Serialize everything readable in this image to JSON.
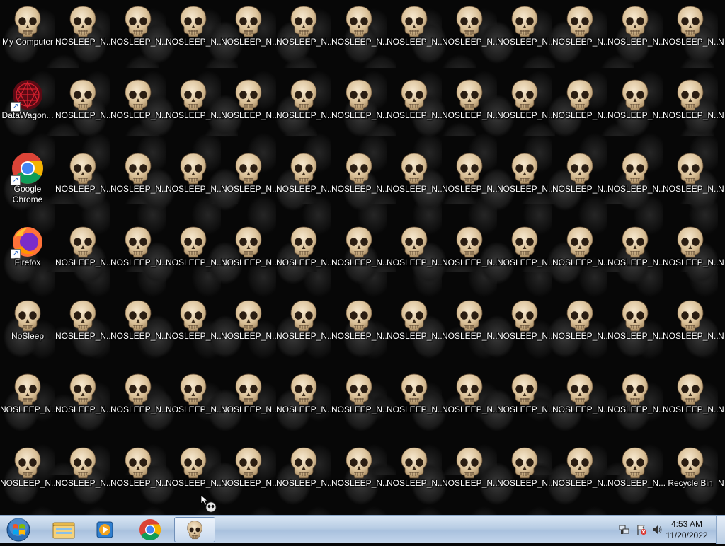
{
  "desktop": {
    "icons": [
      {
        "label": "My Computer",
        "type": "skull"
      },
      {
        "label": "NOSLEEP_N...",
        "type": "skull"
      },
      {
        "label": "NOSLEEP_N...",
        "type": "skull"
      },
      {
        "label": "NOSLEEP_N...",
        "type": "skull"
      },
      {
        "label": "NOSLEEP_N...",
        "type": "skull"
      },
      {
        "label": "NOSLEEP_N...",
        "type": "skull"
      },
      {
        "label": "NOSLEEP_N...",
        "type": "skull"
      },
      {
        "label": "NOSLEEP_N...",
        "type": "skull"
      },
      {
        "label": "NOSLEEP_N...",
        "type": "skull"
      },
      {
        "label": "NOSLEEP_N...",
        "type": "skull"
      },
      {
        "label": "NOSLEEP_N...",
        "type": "skull"
      },
      {
        "label": "NOSLEEP_N...",
        "type": "skull"
      },
      {
        "label": "NOSLEEP_N...",
        "type": "skull"
      },
      {
        "label": "N",
        "type": "none"
      },
      {
        "label": "DataWagon...",
        "type": "datawagon"
      },
      {
        "label": "NOSLEEP_N...",
        "type": "skull"
      },
      {
        "label": "NOSLEEP_N...",
        "type": "skull"
      },
      {
        "label": "NOSLEEP_N...",
        "type": "skull"
      },
      {
        "label": "NOSLEEP_N...",
        "type": "skull"
      },
      {
        "label": "NOSLEEP_N...",
        "type": "skull"
      },
      {
        "label": "NOSLEEP_N...",
        "type": "skull"
      },
      {
        "label": "NOSLEEP_N...",
        "type": "skull"
      },
      {
        "label": "NOSLEEP_N...",
        "type": "skull"
      },
      {
        "label": "NOSLEEP_N...",
        "type": "skull"
      },
      {
        "label": "NOSLEEP_N...",
        "type": "skull"
      },
      {
        "label": "NOSLEEP_N...",
        "type": "skull"
      },
      {
        "label": "NOSLEEP_N...",
        "type": "skull"
      },
      {
        "label": "N",
        "type": "none"
      },
      {
        "label": "Google Chrome",
        "type": "chrome"
      },
      {
        "label": "NOSLEEP_N...",
        "type": "skull"
      },
      {
        "label": "NOSLEEP_N...",
        "type": "skull"
      },
      {
        "label": "NOSLEEP_N...",
        "type": "skull"
      },
      {
        "label": "NOSLEEP_N...",
        "type": "skull"
      },
      {
        "label": "NOSLEEP_N...",
        "type": "skull"
      },
      {
        "label": "NOSLEEP_N...",
        "type": "skull"
      },
      {
        "label": "NOSLEEP_N...",
        "type": "skull"
      },
      {
        "label": "NOSLEEP_N...",
        "type": "skull"
      },
      {
        "label": "NOSLEEP_N...",
        "type": "skull"
      },
      {
        "label": "NOSLEEP_N...",
        "type": "skull"
      },
      {
        "label": "NOSLEEP_N...",
        "type": "skull"
      },
      {
        "label": "NOSLEEP_N...",
        "type": "skull"
      },
      {
        "label": "N",
        "type": "none"
      },
      {
        "label": "Firefox",
        "type": "firefox"
      },
      {
        "label": "NOSLEEP_N...",
        "type": "skull"
      },
      {
        "label": "NOSLEEP_N...",
        "type": "skull"
      },
      {
        "label": "NOSLEEP_N...",
        "type": "skull"
      },
      {
        "label": "NOSLEEP_N...",
        "type": "skull"
      },
      {
        "label": "NOSLEEP_N...",
        "type": "skull"
      },
      {
        "label": "NOSLEEP_N...",
        "type": "skull"
      },
      {
        "label": "NOSLEEP_N...",
        "type": "skull"
      },
      {
        "label": "NOSLEEP_N...",
        "type": "skull"
      },
      {
        "label": "NOSLEEP_N...",
        "type": "skull"
      },
      {
        "label": "NOSLEEP_N...",
        "type": "skull"
      },
      {
        "label": "NOSLEEP_N...",
        "type": "skull"
      },
      {
        "label": "NOSLEEP_N...",
        "type": "skull"
      },
      {
        "label": "N",
        "type": "none"
      },
      {
        "label": "NoSleep",
        "type": "skull"
      },
      {
        "label": "NOSLEEP_N...",
        "type": "skull"
      },
      {
        "label": "NOSLEEP_N...",
        "type": "skull"
      },
      {
        "label": "NOSLEEP_N...",
        "type": "skull"
      },
      {
        "label": "NOSLEEP_N...",
        "type": "skull"
      },
      {
        "label": "NOSLEEP_N...",
        "type": "skull"
      },
      {
        "label": "NOSLEEP_N...",
        "type": "skull"
      },
      {
        "label": "NOSLEEP_N...",
        "type": "skull"
      },
      {
        "label": "NOSLEEP_N...",
        "type": "skull"
      },
      {
        "label": "NOSLEEP_N...",
        "type": "skull"
      },
      {
        "label": "NOSLEEP_N...",
        "type": "skull"
      },
      {
        "label": "NOSLEEP_N...",
        "type": "skull"
      },
      {
        "label": "NOSLEEP_N...",
        "type": "skull"
      },
      {
        "label": "N",
        "type": "none"
      },
      {
        "label": "NOSLEEP_N...",
        "type": "skull"
      },
      {
        "label": "NOSLEEP_N...",
        "type": "skull"
      },
      {
        "label": "NOSLEEP_N...",
        "type": "skull"
      },
      {
        "label": "NOSLEEP_N...",
        "type": "skull"
      },
      {
        "label": "NOSLEEP_N...",
        "type": "skull"
      },
      {
        "label": "NOSLEEP_N...",
        "type": "skull"
      },
      {
        "label": "NOSLEEP_N...",
        "type": "skull"
      },
      {
        "label": "NOSLEEP_N...",
        "type": "skull"
      },
      {
        "label": "NOSLEEP_N...",
        "type": "skull"
      },
      {
        "label": "NOSLEEP_N...",
        "type": "skull"
      },
      {
        "label": "NOSLEEP_N...",
        "type": "skull"
      },
      {
        "label": "NOSLEEP_N...",
        "type": "skull"
      },
      {
        "label": "NOSLEEP_N...",
        "type": "skull"
      },
      {
        "label": "N",
        "type": "none"
      },
      {
        "label": "NOSLEEP_N...",
        "type": "skull"
      },
      {
        "label": "NOSLEEP_N...",
        "type": "skull"
      },
      {
        "label": "NOSLEEP_N...",
        "type": "skull"
      },
      {
        "label": "NOSLEEP_N...",
        "type": "skull"
      },
      {
        "label": "NOSLEEP_N...",
        "type": "skull"
      },
      {
        "label": "NOSLEEP_N...",
        "type": "skull"
      },
      {
        "label": "NOSLEEP_N...",
        "type": "skull"
      },
      {
        "label": "NOSLEEP_N...",
        "type": "skull"
      },
      {
        "label": "NOSLEEP_N...",
        "type": "skull"
      },
      {
        "label": "NOSLEEP_N...",
        "type": "skull"
      },
      {
        "label": "NOSLEEP_N...",
        "type": "skull"
      },
      {
        "label": "NOSLEEP_N...",
        "type": "skull"
      },
      {
        "label": "Recycle Bin",
        "type": "skull"
      },
      {
        "label": "N",
        "type": "none"
      }
    ]
  },
  "taskbar": {
    "start_icon": "windows-orb-icon",
    "pinned": [
      "file-explorer-icon",
      "media-player-icon",
      "chrome-icon",
      "skull-app-icon"
    ],
    "tray": {
      "icons": [
        "network-icon",
        "action-center-flag-icon",
        "volume-icon"
      ],
      "time": "4:53 AM",
      "date": "11/20/2022"
    }
  },
  "colors": {
    "label_text": "#ffffff",
    "taskbar_bg": "#b8cde4",
    "skull_bone": "#e7d2b0"
  }
}
